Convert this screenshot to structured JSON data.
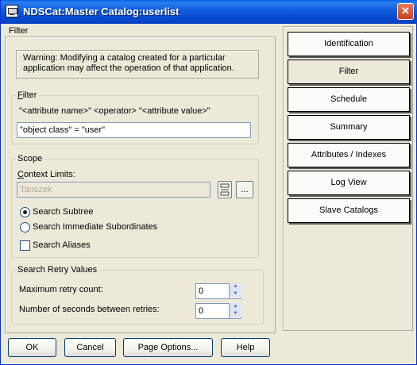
{
  "window": {
    "title": "NDSCat:Master Catalog:userlist",
    "close_glyph": "✕"
  },
  "filter_section_caption": "Filter",
  "warning": {
    "line1": "Warning:  Modifying a catalog created for a particular",
    "line2": "application may affect the operation of that application."
  },
  "filter_group": {
    "legend": "Filter",
    "syntax_hint": "\"<attribute name>\" <operator> \"<attribute value>\"",
    "expression_value": "\"object class\" = \"user\""
  },
  "scope": {
    "legend": "Scope",
    "context_limits_label": "Context Limits:",
    "context_value": "Tanszek",
    "browse_button_label": "...",
    "options": [
      {
        "label": "Search Subtree",
        "checked": true
      },
      {
        "label": "Search Immediate Subordinates",
        "checked": false
      }
    ],
    "search_aliases_label": "Search Aliases",
    "search_aliases_checked": false
  },
  "retry": {
    "legend": "Search Retry Values",
    "max_retry_label": "Maximum retry count:",
    "max_retry_value": "0",
    "seconds_label": "Number of seconds between retries:",
    "seconds_value": "0"
  },
  "tabs": [
    {
      "label": "Identification",
      "active": false
    },
    {
      "label": "Filter",
      "active": true
    },
    {
      "label": "Schedule",
      "active": false
    },
    {
      "label": "Summary",
      "active": false
    },
    {
      "label": "Attributes / Indexes",
      "active": false
    },
    {
      "label": "Log View",
      "active": false
    },
    {
      "label": "Slave Catalogs",
      "active": false
    }
  ],
  "buttons": {
    "ok": "OK",
    "cancel": "Cancel",
    "page_options": "Page Options...",
    "help": "Help"
  },
  "icons": {
    "app": "catalog-window-icon",
    "tree": "context-tree-icon",
    "spinner_up": "▲",
    "spinner_down": "▼"
  }
}
